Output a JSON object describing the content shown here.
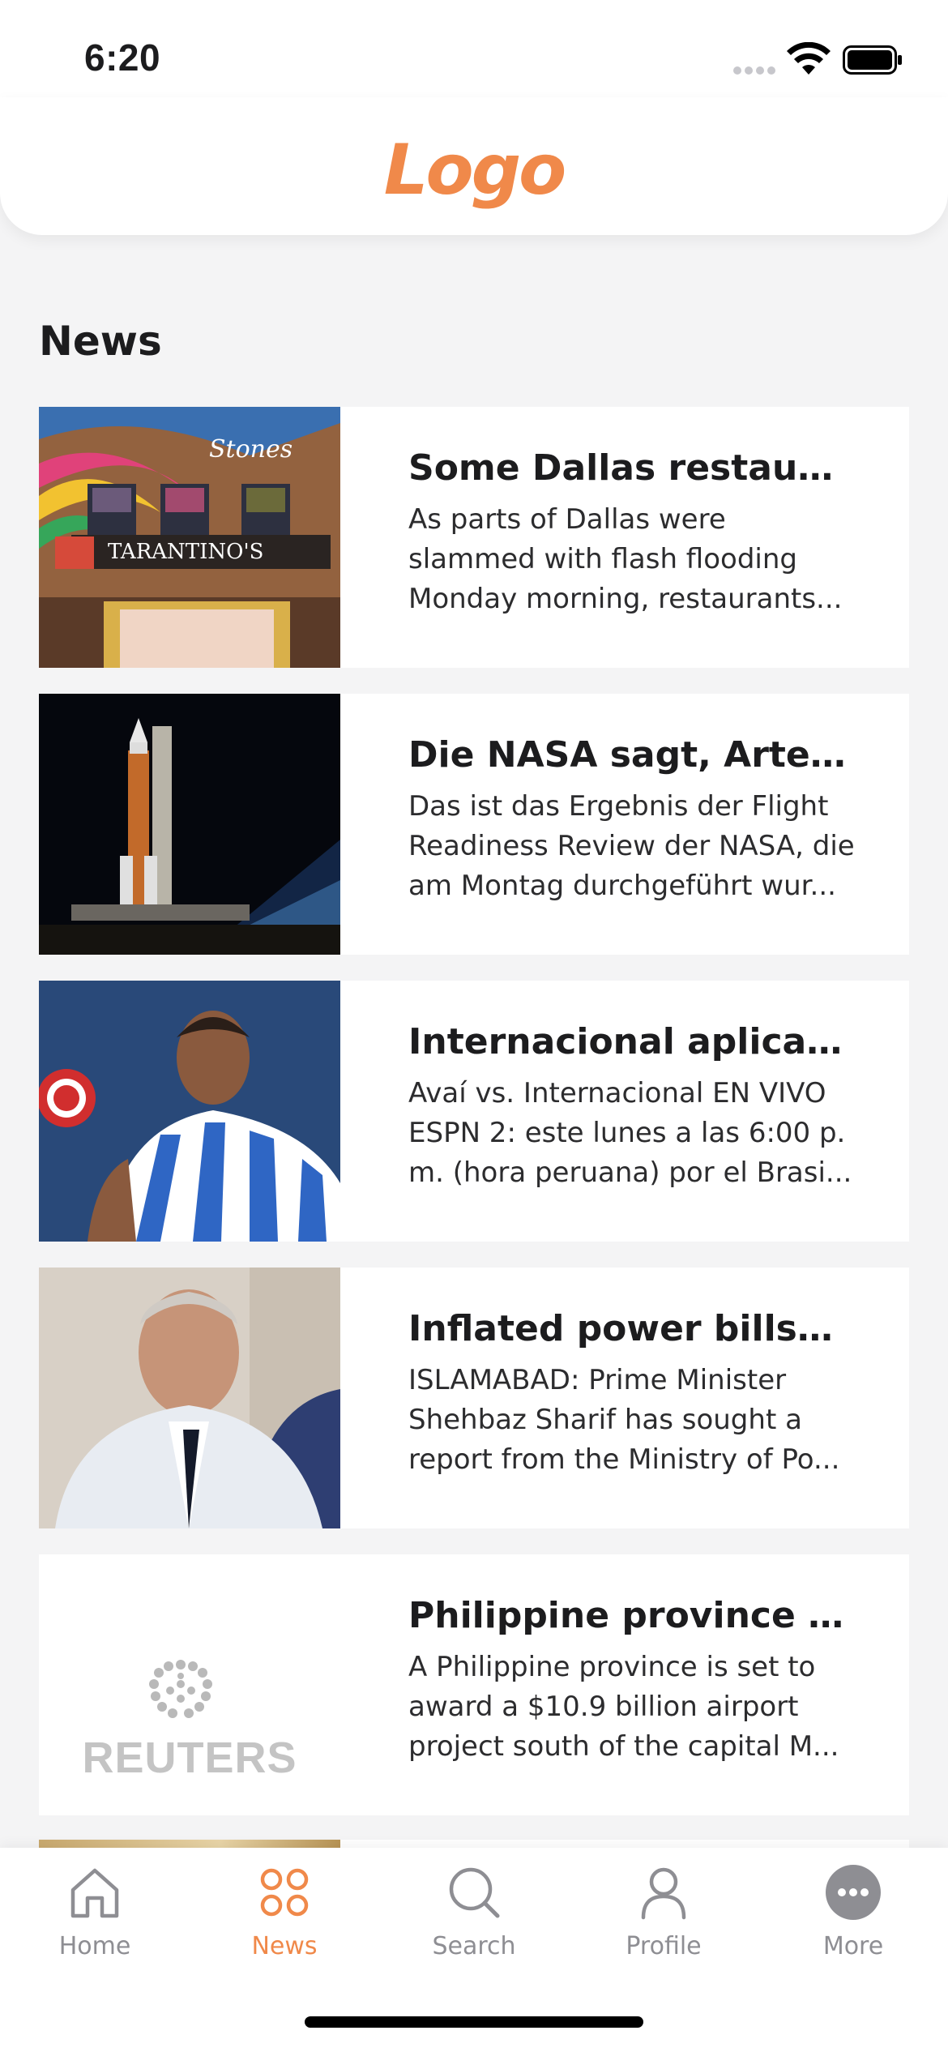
{
  "status_bar": {
    "time": "6:20"
  },
  "header": {
    "logo_text": "Logo"
  },
  "section": {
    "title": "News"
  },
  "news": [
    {
      "title": "Some Dallas restauran...",
      "excerpt": "As parts of Dallas were\nslammed with flash flooding\nMonday morning, restaurants...",
      "image": "tarantinos-restaurant-facade-mural"
    },
    {
      "title": "Die NASA sagt, Artemi...",
      "excerpt": "Das ist das Ergebnis der Flight\nReadiness Review der NASA, die\nam Montag durchgeführt wur...",
      "image": "artemis-rocket-launch-pad-night"
    },
    {
      "title": "Internacional aplica ‘le...",
      "excerpt": "Avaí vs. Internacional EN VIVO\nESPN 2: este lunes a las 6:00 p.\nm. (hora peruana) por el Brasi...",
      "image": "football-player-blue-striped-jersey"
    },
    {
      "title": "Inflated power bills: P...",
      "excerpt": "ISLAMABAD: Prime Minister\nShehbaz Sharif has sought a\nreport from the Ministry of Po...",
      "image": "man-in-white-suit-portrait"
    },
    {
      "title": "Philippine province to...",
      "excerpt": "A Philippine province is set to\naward a $10.9 billion airport\nproject south of the capital M...",
      "image": "reuters-logo-placeholder",
      "image_text": "REUTERS"
    }
  ],
  "tab_bar": {
    "items": [
      {
        "label": "Home",
        "icon": "home-icon",
        "active": false
      },
      {
        "label": "News",
        "icon": "news-grid-icon",
        "active": true
      },
      {
        "label": "Search",
        "icon": "search-icon",
        "active": false
      },
      {
        "label": "Profile",
        "icon": "profile-icon",
        "active": false
      },
      {
        "label": "More",
        "icon": "more-icon",
        "active": false
      }
    ]
  },
  "colors": {
    "accent": "#f0894a",
    "inactive": "#8e8e93",
    "background": "#f4f4f5"
  }
}
